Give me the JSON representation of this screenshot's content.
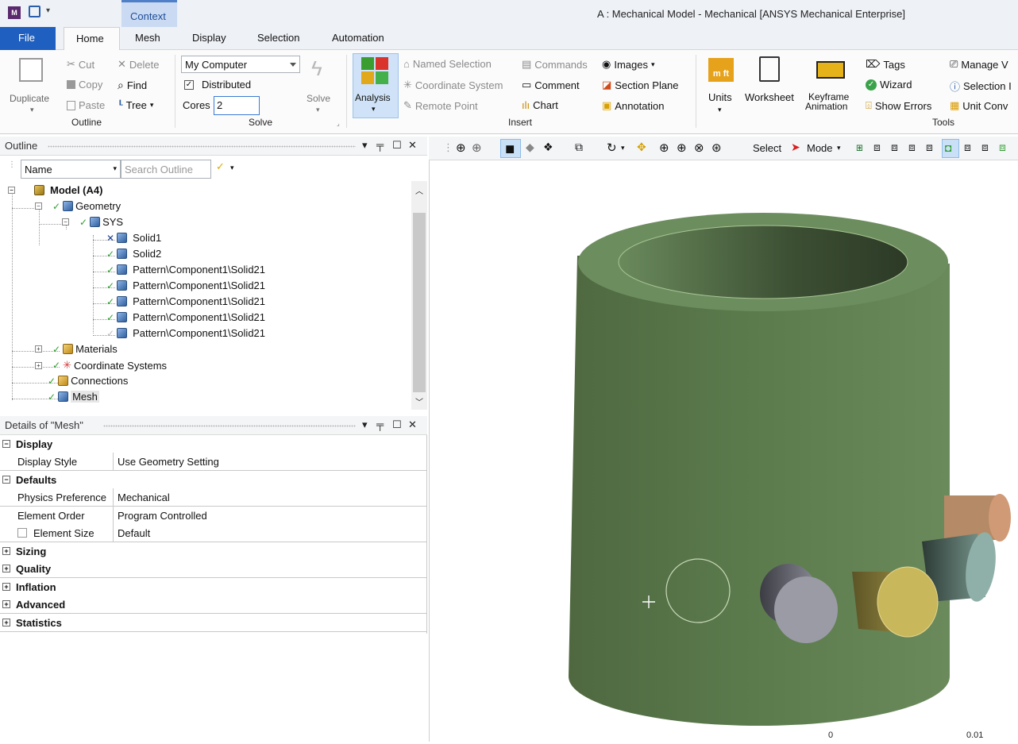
{
  "window": {
    "title": "A : Mechanical Model - Mechanical [ANSYS Mechanical Enterprise]",
    "context_tab": "Context"
  },
  "tabs": [
    "File",
    "Home",
    "Mesh",
    "Display",
    "Selection",
    "Automation"
  ],
  "ribbon": {
    "outline_group": {
      "label": "Outline",
      "duplicate": "Duplicate",
      "cut": "Cut",
      "copy": "Copy",
      "paste": "Paste",
      "delete": "Delete",
      "find": "Find",
      "tree": "Tree"
    },
    "solve_group": {
      "label": "Solve",
      "target": "My Computer",
      "distributed": "Distributed",
      "cores_label": "Cores",
      "cores_value": "2",
      "solve": "Solve"
    },
    "insert_group": {
      "label": "Insert",
      "analysis": "Analysis",
      "named_selection": "Named Selection",
      "coordinate_system": "Coordinate System",
      "remote_point": "Remote Point",
      "commands": "Commands",
      "comment": "Comment",
      "chart": "Chart",
      "images": "Images",
      "section_plane": "Section Plane",
      "annotation": "Annotation"
    },
    "tools_group": {
      "label": "Tools",
      "units": "Units",
      "units_icon_text": "m ft",
      "worksheet": "Worksheet",
      "keyframe_animation_1": "Keyframe",
      "keyframe_animation_2": "Animation",
      "tags": "Tags",
      "wizard": "Wizard",
      "show_errors": "Show Errors",
      "manage_views": "Manage V",
      "selection_info": "Selection I",
      "unit_converter": "Unit Conv"
    }
  },
  "outline": {
    "title": "Outline",
    "filter_name": "Name",
    "search_placeholder": "Search Outline",
    "tree": {
      "model": "Model (A4)",
      "geometry": "Geometry",
      "sys": "SYS",
      "bodies": [
        "Solid1",
        "Solid2",
        "Pattern\\Component1\\Solid21",
        "Pattern\\Component1\\Solid21",
        "Pattern\\Component1\\Solid21",
        "Pattern\\Component1\\Solid21",
        "Pattern\\Component1\\Solid21"
      ],
      "materials": "Materials",
      "coordinate_systems": "Coordinate Systems",
      "connections": "Connections",
      "mesh": "Mesh"
    }
  },
  "details": {
    "title": "Details of \"Mesh\"",
    "rows": [
      {
        "type": "section",
        "key": "Display",
        "expanded": true
      },
      {
        "type": "prop",
        "key": "Display Style",
        "value": "Use Geometry Setting"
      },
      {
        "type": "section",
        "key": "Defaults",
        "expanded": true
      },
      {
        "type": "prop",
        "key": "Physics Preference",
        "value": "Mechanical"
      },
      {
        "type": "prop",
        "key": "Element Order",
        "value": "Program Controlled"
      },
      {
        "type": "checkprop",
        "key": "Element Size",
        "value": "Default"
      },
      {
        "type": "section",
        "key": "Sizing",
        "expanded": false
      },
      {
        "type": "section",
        "key": "Quality",
        "expanded": false
      },
      {
        "type": "section",
        "key": "Inflation",
        "expanded": false
      },
      {
        "type": "section",
        "key": "Advanced",
        "expanded": false
      },
      {
        "type": "section",
        "key": "Statistics",
        "expanded": false
      }
    ]
  },
  "graphics_toolbar": {
    "select": "Select",
    "mode": "Mode"
  },
  "viewport": {
    "scale_left": "0",
    "scale_right": "0.01"
  },
  "colors": {
    "file_tab": "#1e5fbf",
    "body_green": "#5d7a4f",
    "selected_tool": "#c9e0f7"
  }
}
